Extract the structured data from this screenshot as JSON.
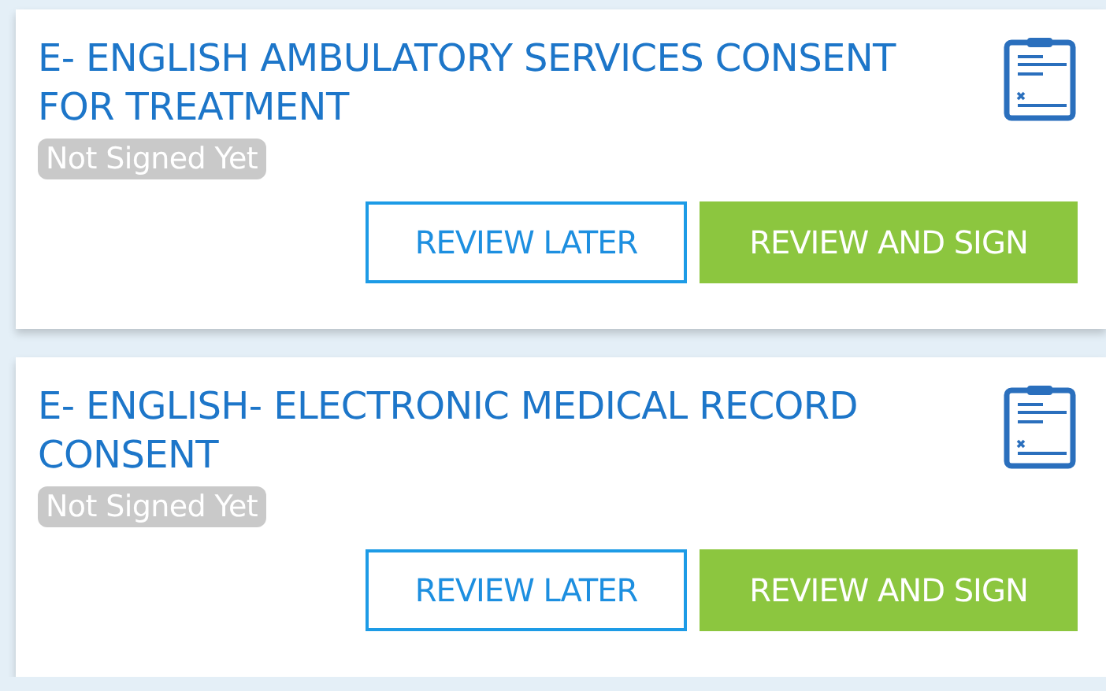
{
  "documents": [
    {
      "title": "E- ENGLISH AMBULATORY SERVICES CONSENT FOR TREATMENT",
      "status": "Not Signed Yet",
      "buttons": [
        {
          "label": "REVIEW LATER",
          "kind": "outline"
        },
        {
          "label": "REVIEW AND SIGN",
          "kind": "primary"
        }
      ]
    },
    {
      "title": "E- ENGLISH- ELECTRONIC MEDICAL RECORD CONSENT",
      "status": "Not Signed Yet",
      "buttons": [
        {
          "label": "REVIEW LATER",
          "kind": "outline"
        },
        {
          "label": "REVIEW AND SIGN",
          "kind": "primary"
        }
      ]
    }
  ]
}
